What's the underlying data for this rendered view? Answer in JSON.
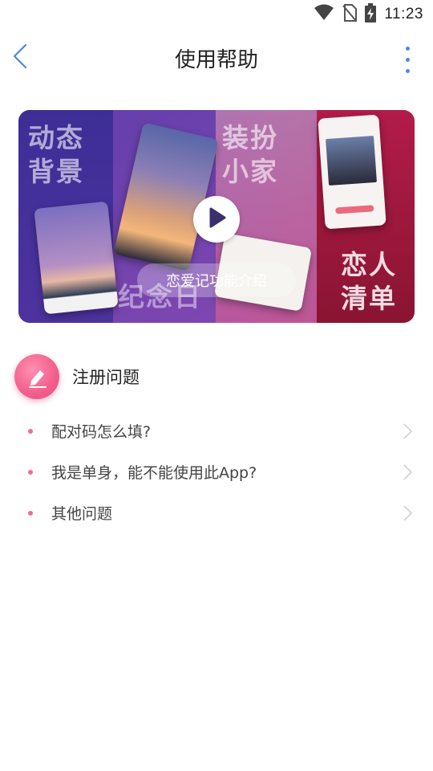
{
  "status_bar": {
    "time": "11:23",
    "icons": [
      "wifi-icon",
      "no-sim-icon",
      "battery-charging-icon"
    ]
  },
  "header": {
    "title": "使用帮助",
    "back_icon": "chevron-left-icon",
    "more_icon": "more-vertical-icon",
    "accent_color": "#4a86e8"
  },
  "banner": {
    "words": [
      "动态\n背景",
      "装扮\n小家",
      "纪念日",
      "恋人\n清单"
    ],
    "caption": "恋爱记功能介绍",
    "play_icon": "play-icon"
  },
  "section": {
    "title": "注册问题",
    "icon": "pencil-edit-icon",
    "icon_color": "#f35e8c"
  },
  "faq": [
    {
      "label": "配对码怎么填?"
    },
    {
      "label": "我是单身，能不能使用此App?"
    },
    {
      "label": "其他问题"
    }
  ]
}
